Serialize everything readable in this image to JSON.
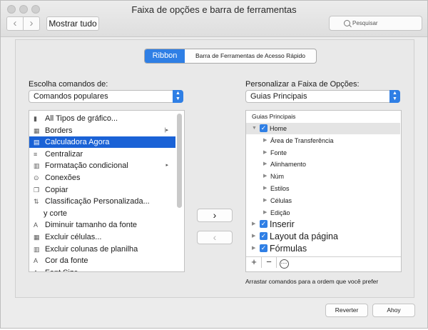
{
  "window": {
    "title": "Faixa de opções e barra de ferramentas"
  },
  "toolbar": {
    "show_all": "Mostrar tudo",
    "search_placeholder": "Pesquisar"
  },
  "tabs": {
    "ribbon": "Ribbon",
    "qat": "Barra de Ferramentas de Acesso Rápido"
  },
  "left": {
    "label": "Escolha comandos de:",
    "dropdown_value": "Comandos populares",
    "items": [
      {
        "label": "All Tipos de gráfico...",
        "icon": "chart-icon"
      },
      {
        "label": "Borders",
        "icon": "borders-icon",
        "submenu": "|▸"
      },
      {
        "label": "Calculadora Agora",
        "icon": "calculator-icon",
        "selected": true
      },
      {
        "label": "Centralizar",
        "icon": "center-icon"
      },
      {
        "label": "Formatação condicional",
        "icon": "conditional-format-icon",
        "submenu": "▸"
      },
      {
        "label": "Conexões",
        "icon": "connections-icon"
      },
      {
        "label": "Copiar",
        "icon": "copy-icon"
      },
      {
        "label": "Classificação Personalizada...",
        "icon": "sort-icon"
      },
      {
        "label": "y corte",
        "icon": ""
      },
      {
        "label": "Diminuir tamanho da fonte",
        "icon": "decrease-font-icon"
      },
      {
        "label": "Excluir células...",
        "icon": "delete-cells-icon"
      },
      {
        "label": "Excluir colunas de planilha",
        "icon": "delete-columns-icon"
      },
      {
        "label": "Cor da fonte",
        "icon": "font-color-icon"
      },
      {
        "label": "Font Size",
        "icon": "font-size-icon"
      }
    ]
  },
  "right": {
    "label": "Personalizar a Faixa de Opções:",
    "dropdown_value": "Guias Principais",
    "header": "Guias Principais",
    "tree": [
      {
        "label": "Home",
        "level": 0,
        "checked": true,
        "expanded": true
      },
      {
        "label": "Área de Transferência",
        "level": 1
      },
      {
        "label": "Fonte",
        "level": 1
      },
      {
        "label": "Alinhamento",
        "level": 1
      },
      {
        "label": "Núm",
        "level": 1
      },
      {
        "label": "Estilos",
        "level": 1
      },
      {
        "label": "Células",
        "level": 1
      },
      {
        "label": "Edição",
        "level": 1
      },
      {
        "label": "Inserir",
        "level": 0,
        "checked": true
      },
      {
        "label": "Layout da página",
        "level": 0,
        "checked": true
      },
      {
        "label": "Fórmulas",
        "level": 0,
        "checked": true
      }
    ],
    "tools": {
      "add": "+",
      "remove": "−",
      "more": "⋯"
    },
    "hint": "Arrastar comandos para a ordem que você prefer"
  },
  "buttons": {
    "revert": "Reverter",
    "ok": "Ahoy"
  },
  "colors": {
    "accent": "#2f7fe5",
    "selection": "#1a62d6"
  }
}
